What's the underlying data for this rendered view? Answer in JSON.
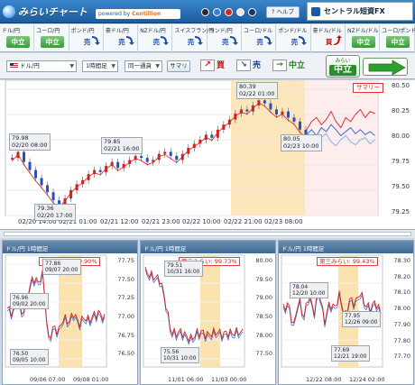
{
  "header": {
    "logo_text": "みらいチャート",
    "powered_by": "powered by ",
    "powered_brand": "Centillion",
    "help_label": "? ヘルプ",
    "broker": "セントラル短資FX",
    "theme_dots": [
      "#2a2a2a",
      "#3a7bd5",
      "#cc2a2a",
      "#e9e9e9",
      "#1e2e5e"
    ]
  },
  "ticker": [
    {
      "pair": "ドル/円",
      "signal": "中立",
      "kind": "neutral"
    },
    {
      "pair": "ユーロ/円",
      "signal": "中立",
      "kind": "neutral"
    },
    {
      "pair": "ポンド/円",
      "signal": "売",
      "kind": "sell"
    },
    {
      "pair": "豪ドル/円",
      "signal": "売",
      "kind": "sell"
    },
    {
      "pair": "NZドル/円",
      "signal": "売",
      "kind": "sell"
    },
    {
      "pair": "スイスフラン/円",
      "signal": "売",
      "kind": "sell"
    },
    {
      "pair": "ランド/円",
      "signal": "売",
      "kind": "sell"
    },
    {
      "pair": "ユーロ/ドル",
      "signal": "売",
      "kind": "sell"
    },
    {
      "pair": "ポンド/ドル",
      "signal": "売",
      "kind": "sell"
    },
    {
      "pair": "豪ドル/ドル",
      "signal": "買",
      "kind": "buy"
    },
    {
      "pair": "NZドル/ドル",
      "signal": "中立",
      "kind": "neutral"
    },
    {
      "pair": "ユーロ/ポンド",
      "signal": "中立",
      "kind": "neutral"
    }
  ],
  "toolbar": {
    "pair_select": "ドル/円",
    "period_select": "1時間足",
    "mode_select": "同一通貨",
    "summary_button": "サマリ",
    "buy_label": "買",
    "sell_label": "売",
    "neutral_label": "中立",
    "mirai_label": "みらい",
    "mirai_value": "中立"
  },
  "main_chart": {
    "summary_tag": "サマリー",
    "y_ticks": [
      "80.50",
      "80.25",
      "80.00",
      "79.75",
      "79.50",
      "79.25"
    ],
    "x_ticks": [
      "02/20 14:00",
      "02/21 01:00",
      "02/21 12:00",
      "02/21 23:00",
      "02/22 10:00",
      "02/22 21:00",
      "02/23 08:00"
    ],
    "callouts": [
      {
        "price": "79.98",
        "time": "02/20 08:00"
      },
      {
        "price": "79.85",
        "time": "02/21 16:00"
      },
      {
        "price": "79.36",
        "time": "02/20 17:00"
      },
      {
        "price": "80.39",
        "time": "02/22 01:00"
      },
      {
        "price": "80.05",
        "time": "02/23 10:00"
      }
    ]
  },
  "subcharts": [
    {
      "head": "ドル/円 1時間足",
      "label": "第一みらい: 99.90%",
      "y_ticks": [
        "77.75",
        "77.50",
        "77.25",
        "77.00",
        "76.75",
        "76.50"
      ],
      "x_ticks": [
        "09/06 07:00",
        "09/08 01:00"
      ],
      "callouts": [
        {
          "price": "77.86",
          "time": "09/07 20:00"
        },
        {
          "price": "76.96",
          "time": "09/02 20:00"
        },
        {
          "price": "76.50",
          "time": "09/05 10:00"
        }
      ]
    },
    {
      "head": "ドル/円 1時間足",
      "label": "第二みらい: 99.73%",
      "y_ticks": [
        "80.00",
        "79.50",
        "79.00",
        "78.50",
        "78.00",
        "77.50"
      ],
      "x_ticks": [
        "11/01 06:00",
        "11/03 00:00"
      ],
      "callouts": [
        {
          "price": "79.51",
          "time": "10/31 16:00"
        },
        {
          "price": "75.56",
          "time": "10/31 10:00"
        }
      ]
    },
    {
      "head": "ドル/円 1時間足",
      "label": "第三みらい: 99.43%",
      "y_ticks": [
        "78.30",
        "78.20",
        "78.10",
        "78.00",
        "77.90",
        "77.80",
        "77.70"
      ],
      "x_ticks": [
        "12/22 08:00",
        "12/24 02:00"
      ],
      "callouts": [
        {
          "price": "78.04",
          "time": "12/20 10:00"
        },
        {
          "price": "77.95",
          "time": "12/26 09:00"
        },
        {
          "price": "77.69",
          "time": "12/21 19:00"
        }
      ]
    }
  ]
}
